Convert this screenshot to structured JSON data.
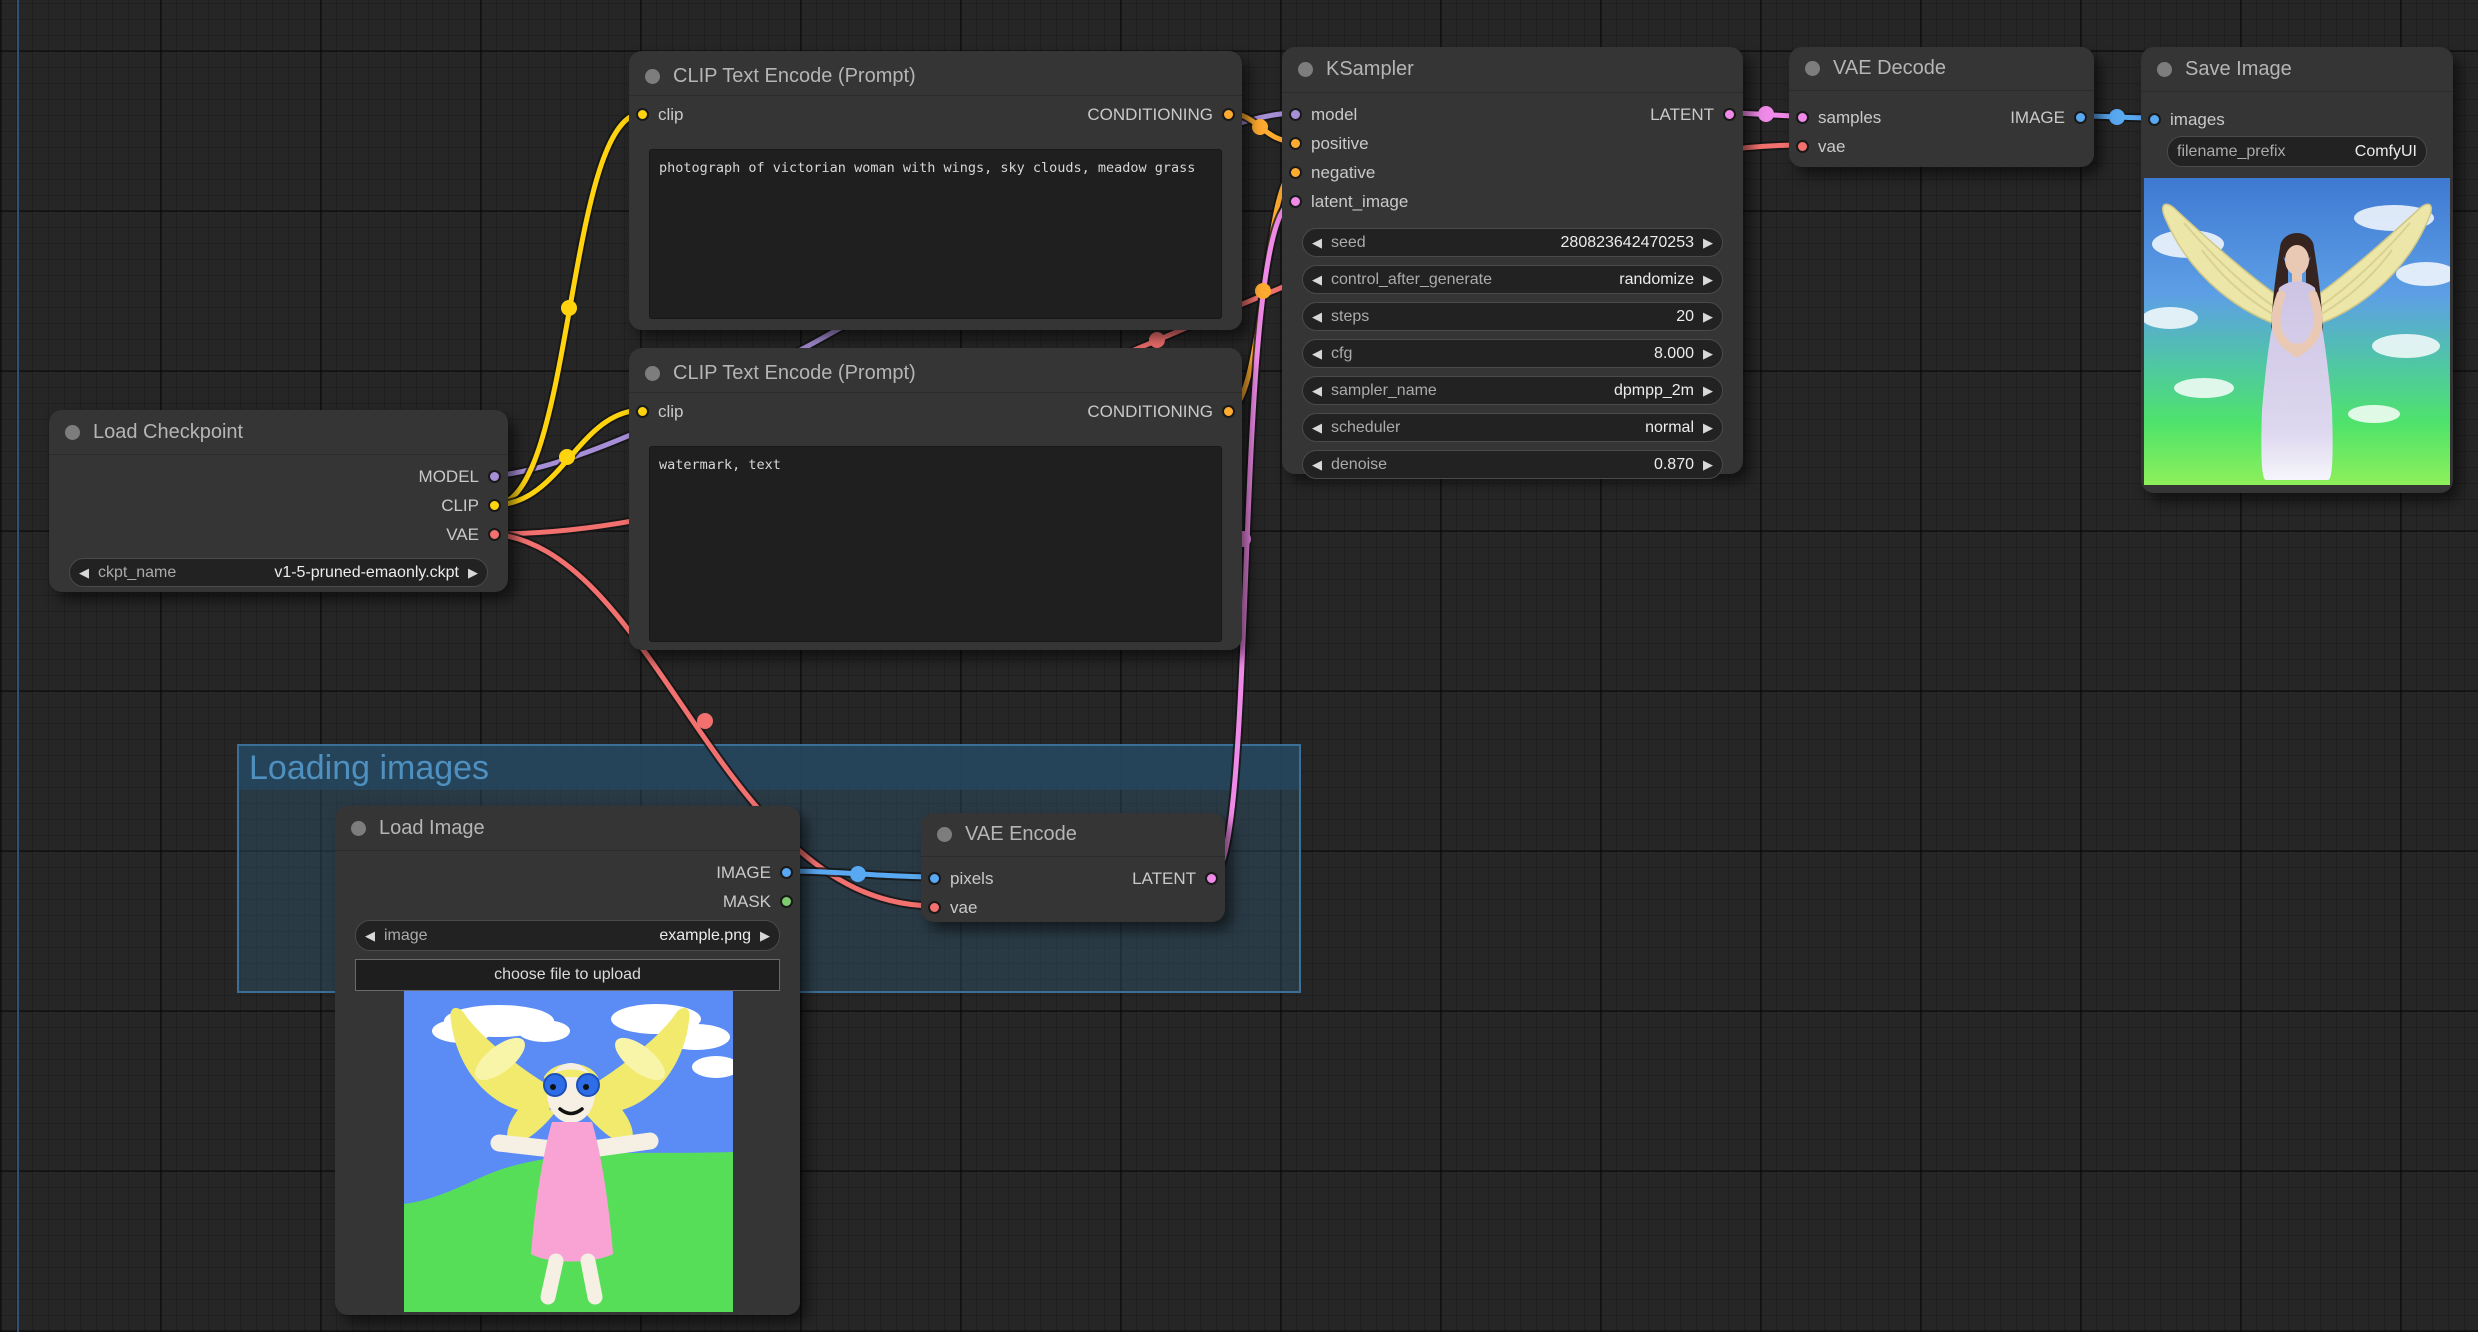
{
  "ui": {
    "arrow_left": "◀",
    "arrow_right": "▶"
  },
  "canvas": {
    "boundary_color": "#2e5075"
  },
  "port_colors": {
    "model": "#a78fd8",
    "clip": "#ffd40f",
    "vae": "#f2716f",
    "conditioning": "#ffab30",
    "latent": "#f08ae8",
    "image": "#59a8f2",
    "mask": "#7fca6f"
  },
  "group": {
    "title": "Loading images",
    "border_color": "#3d6f96",
    "title_color": "#4e90c0"
  },
  "nodes": {
    "load_checkpoint": {
      "title": "Load Checkpoint",
      "outputs": [
        {
          "label": "MODEL"
        },
        {
          "label": "CLIP"
        },
        {
          "label": "VAE"
        }
      ],
      "widget": {
        "label": "ckpt_name",
        "value": "v1-5-pruned-emaonly.ckpt"
      }
    },
    "clip_encode_positive": {
      "title": "CLIP Text Encode (Prompt)",
      "input": "clip",
      "output": "CONDITIONING",
      "text": "photograph of victorian woman with wings, sky clouds, meadow grass"
    },
    "clip_encode_negative": {
      "title": "CLIP Text Encode (Prompt)",
      "input": "clip",
      "output": "CONDITIONING",
      "text": "watermark, text"
    },
    "ksampler": {
      "title": "KSampler",
      "inputs": [
        "model",
        "positive",
        "negative",
        "latent_image"
      ],
      "output": "LATENT",
      "widgets": [
        {
          "label": "seed",
          "value": "280823642470253"
        },
        {
          "label": "control_after_generate",
          "value": "randomize"
        },
        {
          "label": "steps",
          "value": "20"
        },
        {
          "label": "cfg",
          "value": "8.000"
        },
        {
          "label": "sampler_name",
          "value": "dpmpp_2m"
        },
        {
          "label": "scheduler",
          "value": "normal"
        },
        {
          "label": "denoise",
          "value": "0.870"
        }
      ]
    },
    "vae_decode": {
      "title": "VAE Decode",
      "inputs": [
        "samples",
        "vae"
      ],
      "output": "IMAGE"
    },
    "save_image": {
      "title": "Save Image",
      "input": "images",
      "widget": {
        "label": "filename_prefix",
        "value": "ComfyUI"
      }
    },
    "load_image": {
      "title": "Load Image",
      "outputs": [
        "IMAGE",
        "MASK"
      ],
      "widget": {
        "label": "image",
        "value": "example.png"
      },
      "button": "choose file to upload"
    },
    "vae_encode": {
      "title": "VAE Encode",
      "inputs": [
        "pixels",
        "vae"
      ],
      "output": "LATENT"
    }
  }
}
